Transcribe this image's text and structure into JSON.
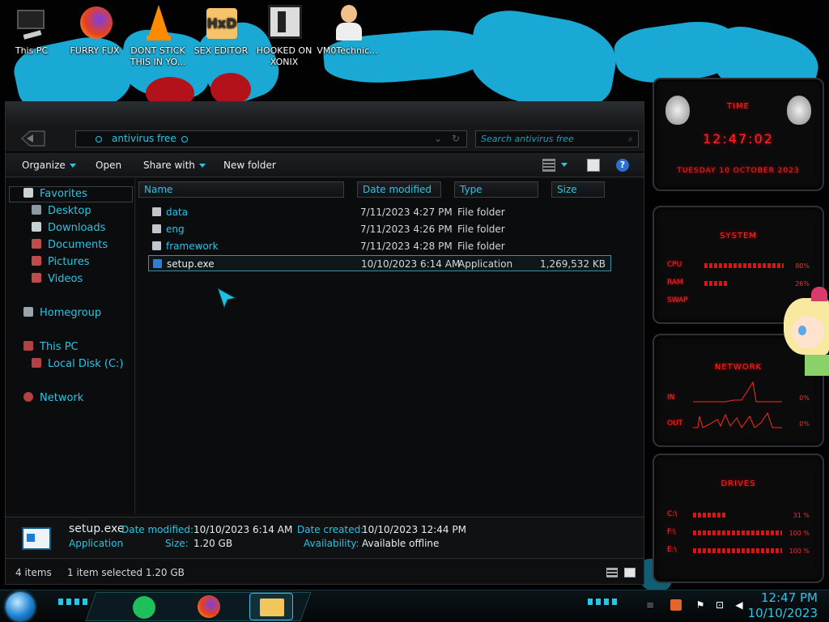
{
  "desktop": {
    "icons": [
      {
        "label": "This PC",
        "icon": "computer-icon"
      },
      {
        "label": "FURRY FUX",
        "icon": "firefox-icon"
      },
      {
        "label": "DONT STICK THIS IN YO...",
        "icon": "vlc-icon"
      },
      {
        "label": "SEX EDITOR",
        "icon": "hxd-icon"
      },
      {
        "label": "HOOKED ON XONIX",
        "icon": "game-icon"
      },
      {
        "label": "VM0Technic...",
        "icon": "doctor-icon"
      }
    ]
  },
  "explorer": {
    "address": "antivirus free",
    "search_placeholder": "Search antivirus free",
    "toolbar": {
      "organize": "Organize",
      "open": "Open",
      "share_with": "Share with",
      "new_folder": "New folder"
    },
    "nav": {
      "favorites": "Favorites",
      "desktop": "Desktop",
      "downloads": "Downloads",
      "documents": "Documents",
      "pictures": "Pictures",
      "videos": "Videos",
      "homegroup": "Homegroup",
      "this_pc": "This PC",
      "local_disk": "Local Disk (C:)",
      "network": "Network"
    },
    "columns": {
      "name": "Name",
      "date_modified": "Date modified",
      "type": "Type",
      "size": "Size"
    },
    "files": [
      {
        "name": "data",
        "date": "7/11/2023 4:27 PM",
        "type": "File folder",
        "size": ""
      },
      {
        "name": "eng",
        "date": "7/11/2023 4:26 PM",
        "type": "File folder",
        "size": ""
      },
      {
        "name": "framework",
        "date": "7/11/2023 4:28 PM",
        "type": "File folder",
        "size": ""
      },
      {
        "name": "setup.exe",
        "date": "10/10/2023 6:14 AM",
        "type": "Application",
        "size": "1,269,532 KB"
      }
    ],
    "details": {
      "name": "setup.exe",
      "kind": "Application",
      "date_modified_label": "Date modified:",
      "date_modified": "10/10/2023 6:14 AM",
      "size_label": "Size:",
      "size": "1.20 GB",
      "date_created_label": "Date created:",
      "date_created": "10/10/2023 12:44 PM",
      "availability_label": "Availability:",
      "availability": "Available offline"
    },
    "status": {
      "items": "4 items",
      "selected": "1 item selected  1.20 GB"
    }
  },
  "gadgets": {
    "time": {
      "title": "TIME",
      "clock": "12:47:02",
      "date": "TUESDAY 10 OCTOBER 2023"
    },
    "system": {
      "title": "SYSTEM",
      "cpu_label": "CPU",
      "cpu_value": "80%",
      "ram_label": "RAM",
      "ram_value": "26%",
      "swap_label": "SWAP"
    },
    "network": {
      "title": "NETWORK",
      "in_label": "IN",
      "in_value": "0%",
      "out_label": "OUT",
      "out_value": "0%"
    },
    "drives": {
      "title": "DRIVES",
      "drives": [
        {
          "label": "C:\\",
          "value": "31 %"
        },
        {
          "label": "F:\\",
          "value": "100 %"
        },
        {
          "label": "E:\\",
          "value": "100 %"
        }
      ]
    }
  },
  "taskbar": {
    "time": "12:47 PM",
    "date": "10/10/2023"
  },
  "colors": {
    "accent": "#29c5e6",
    "gadget_red": "#ff2626",
    "window_bg": "#0d0f11"
  }
}
